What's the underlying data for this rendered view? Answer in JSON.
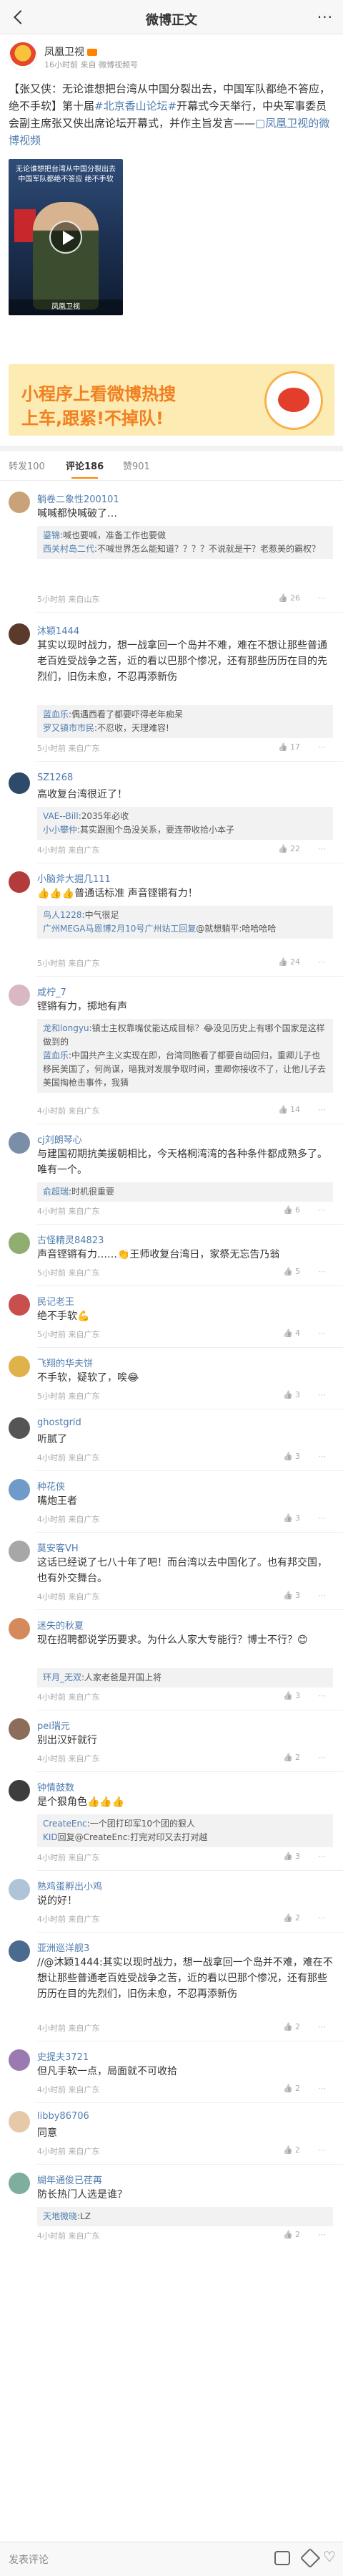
{
  "header": {
    "title": "微博正文",
    "more": "···"
  },
  "post": {
    "author": "凤凰卫视",
    "meta": "16小时前 来自 微博视频号",
    "text_a": "【张又侠：无论谁想把台湾从中国分裂出去，中国军队都绝不答应，绝不手软】第十届",
    "hashtag": "#北京香山论坛#",
    "text_b": "开幕式今天举行，中央军事委员会副主席张又侠出席论坛开幕式，并作主旨发言——",
    "video_link": "凤凰卫视的微博视频",
    "video": {
      "caption": "无论谁想把台湾从中国分裂出去 中国军队都绝不答应 绝不手软",
      "badge": "凤凰卫视"
    }
  },
  "banner": {
    "line1": "小程序上看微博热搜",
    "line2": "上车,跟紧!不掉队!"
  },
  "tabs": [
    {
      "label": "转发100"
    },
    {
      "label": "评论186"
    },
    {
      "label": "赞901"
    }
  ],
  "comments": [
    {
      "user": "躺卷二象性200101",
      "body": "喊喊都快喊破了…",
      "replies": [
        {
          "name": "鎏锦",
          "text": ":喊也要喊，准备工作也要做"
        },
        {
          "name": "西关村岛二代",
          "text": ":不喊世界怎么能知道？？？？不说就是干？老惹美的霸权？"
        }
      ],
      "time": "5小时前 来自山东",
      "likes": "26"
    },
    {
      "user": "沐颖1444",
      "body": "其实以现时战力，想一战拿回一个岛并不难，难在不想让那些普通老百姓受战争之苦，近的看以巴那个惨况，还有那些历历在目的先烈们，旧伤未愈，不忍再添新伤",
      "replies": [
        {
          "name": "蓝血乐",
          "text": ":偶遇西看了都要吓得老年痴呆"
        },
        {
          "name": "罗又镇市市民",
          "text": ":不忍收，天理难容!"
        }
      ],
      "time": "5小时前 来自广东",
      "likes": "17"
    },
    {
      "user": "SZ1268",
      "body": "高收复台湾很近了！",
      "replies": [
        {
          "name": "VAE--Bill",
          "text": ":2035年必收"
        },
        {
          "name": "小小攀仲",
          "text": ":其实跟图个岛没关系，要连带收拾小本子"
        }
      ],
      "time": "4小时前 来自广东",
      "likes": "22"
    },
    {
      "user": "小脑斧大掘几111",
      "body": "👍👍👍普通话标准 声音铿锵有力！",
      "replies": [
        {
          "name": "鸟人1228",
          "text": ":中气很足"
        },
        {
          "name": "广州MEGA马恩博2月10号广州站工回复",
          "text": "@就想躺平:哈哈哈哈"
        }
      ],
      "time": "5小时前 来自广东",
      "likes": "24"
    },
    {
      "user": "咸柠_7",
      "body": "铿锵有力，掷地有声",
      "replies": [
        {
          "name": "龙和longyu",
          "text": ":镇士主权靠嘴仗能达成目标？😂没见历史上有哪个国家是这样做到的"
        },
        {
          "name": "蓝血乐",
          "text": ":中国共产主义实现在即，台湾同胞看了都要自动回归，重卿儿子也移民美国了，何尚谋，暗我对发展争取时间，重卿你接收不了，让他儿子去美国掏枪击事件，我猜"
        }
      ],
      "time": "4小时前 来自广东",
      "likes": "14"
    },
    {
      "user": "cj刘朗琴心",
      "body": "与建国初期抗美援朝相比，今天格桐湾湾的各种条件都成熟多了。唯有一个。",
      "replies": [
        {
          "name": "俞超瑞",
          "text": ":时机很重要"
        }
      ],
      "time": "4小时前 来自广东",
      "likes": "6"
    },
    {
      "user": "古怪精灵84823",
      "body": "声音铿锵有力……👏王师收复台湾日，家祭无忘告乃翁",
      "replies": [],
      "time": "5小时前 来自广东",
      "likes": "5"
    },
    {
      "user": "民记老王",
      "body": "绝不手软💪",
      "replies": [],
      "time": "5小时前 来自广东",
      "likes": "4"
    },
    {
      "user": "飞翔的华夫饼",
      "body": "不手软，疑软了，唉😂",
      "replies": [],
      "time": "5小时前 来自广东",
      "likes": "3"
    },
    {
      "user": "ghostgrid",
      "body": "听腻了",
      "replies": [],
      "time": "4小时前 来自广东",
      "likes": "3"
    },
    {
      "user": "种花侠",
      "body": "嘴炮王者",
      "replies": [],
      "time": "4小时前 来自广东",
      "likes": "3"
    },
    {
      "user": "莫安客VH",
      "body": "这话已经说了七八十年了吧！而台湾以去中国化了。也有邦交国，也有外交舞台。",
      "replies": [],
      "time": "4小时前 来自广东",
      "likes": "3"
    },
    {
      "user": "迷失的秋夏",
      "body": "现在招聘都说学历要求。为什么人家大专能行？博士不行？😊",
      "replies": [
        {
          "name": "环月_无双",
          "text": ":人家老爸是开国上将"
        }
      ],
      "time": "4小时前 来自广东",
      "likes": "3"
    },
    {
      "user": "pei瑞元",
      "body": "别出汉奸就行",
      "replies": [],
      "time": "4小时前 来自广东",
      "likes": "2"
    },
    {
      "user": "钟情鼓数",
      "body": "是个狠角色👍👍👍",
      "replies": [
        {
          "name": "CreateEnc",
          "text": ":一个团打印军10个团的狠人"
        },
        {
          "name": "KID",
          "text": "回复@CreateEnc:打完对印又去打对越"
        }
      ],
      "time": "4小时前 来自广东",
      "likes": "3"
    },
    {
      "user": "熟鸡蛋孵出小鸡",
      "body": "说的好！",
      "replies": [],
      "time": "4小时前 来自广东",
      "likes": "2"
    },
    {
      "user": "亚洲巡洋舰3",
      "body": "//@沐颖1444:其实以现时战力，想一战拿回一个岛并不难，难在不想让那些普通老百姓受战争之苦，近的看以巴那个惨况，还有那些历历在目的先烈们，旧伤未愈，不忍再添新伤",
      "replies": [],
      "time": "4小时前 来自广东",
      "likes": "2"
    },
    {
      "user": "史提夫3721",
      "body": "但凡手软一点，局面就不可收拾",
      "replies": [],
      "time": "4小时前 来自广东",
      "likes": "2"
    },
    {
      "user": "libby86706",
      "body": "同意",
      "replies": [],
      "time": "4小时前 来自广东",
      "likes": "2"
    },
    {
      "user": "蝴年通俊已荏苒",
      "body": "防长热门人选是谁？",
      "replies": [
        {
          "name": "天地微晓",
          "text": ":LZ"
        }
      ],
      "time": "4小时前 来自广东",
      "likes": "2"
    }
  ],
  "bottom": {
    "input_label": "发表评论"
  },
  "colors": {
    "link": "#507daf",
    "accent": "#ff8200"
  }
}
